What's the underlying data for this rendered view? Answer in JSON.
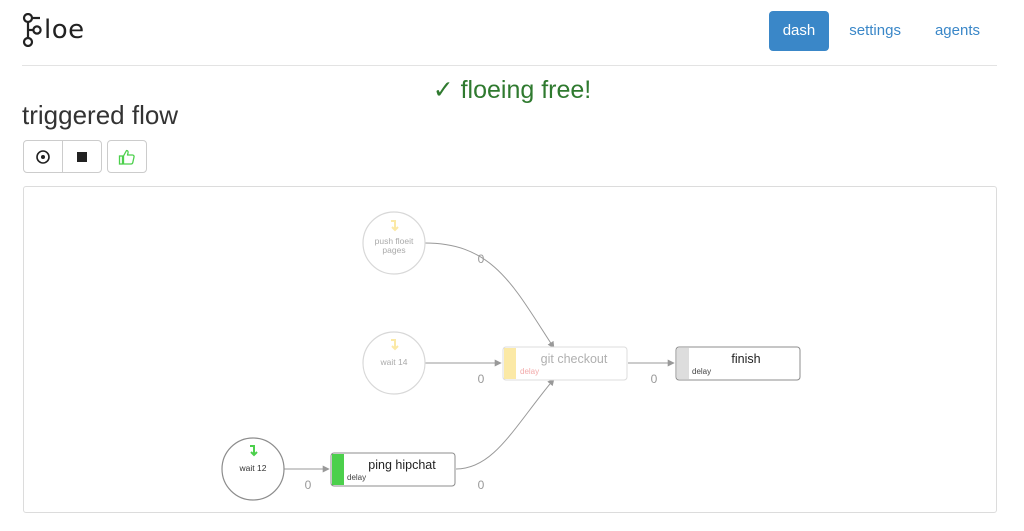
{
  "brand": {
    "name": "loe"
  },
  "nav": {
    "dash": "dash",
    "settings": "settings",
    "agents": "agents"
  },
  "status_message": "✓ floeing free!",
  "page_title": "triggered flow",
  "toolbar": {
    "play_icon": "play-circle-icon",
    "stop_icon": "stop-square-icon",
    "approve_icon": "thumbs-up-icon"
  },
  "flow": {
    "nodes": {
      "push_floeit": {
        "line1": "push floeit",
        "line2": "pages"
      },
      "wait14": {
        "label": "wait 14"
      },
      "wait12": {
        "label": "wait 12"
      },
      "git_checkout": {
        "title": "git checkout",
        "sub": "delay"
      },
      "finish": {
        "title": "finish",
        "sub": "delay"
      },
      "ping_hipchat": {
        "title": "ping hipchat",
        "sub": "delay"
      }
    },
    "edge_labels": {
      "push_to_git": "0",
      "wait14_to_git": "0",
      "git_to_finish": "0",
      "wait12_to_ping": "0",
      "ping_to_git": "0"
    },
    "colors": {
      "pending": "#fbe9a6",
      "running": "#4cd04c",
      "idle": "#dddddd",
      "edge": "#999999"
    }
  }
}
